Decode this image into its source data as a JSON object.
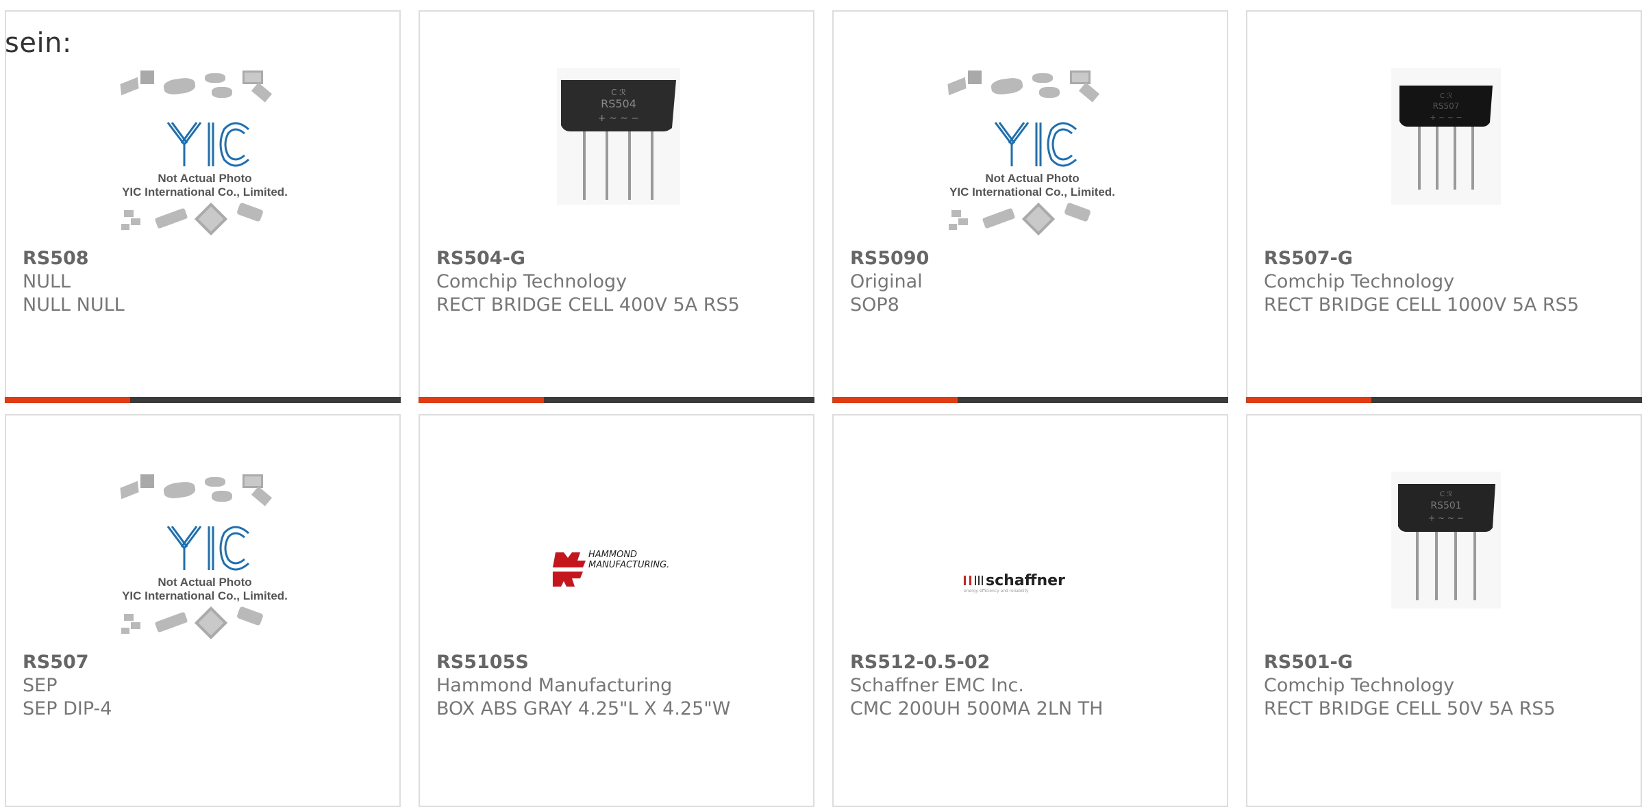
{
  "heading_fragment": "sein:",
  "products": [
    {
      "part": "RS508",
      "maker": "NULL",
      "desc": "NULL NULL",
      "image": "yic-placeholder-image"
    },
    {
      "part": "RS504-G",
      "maker": "Comchip Technology",
      "desc": "RECT BRIDGE CELL 400V 5A RS5",
      "image": "bridge-rectifier-photo",
      "chip_text": "RS504"
    },
    {
      "part": "RS5090",
      "maker": "Original",
      "desc": "SOP8",
      "image": "yic-placeholder-image"
    },
    {
      "part": "RS507-G",
      "maker": "Comchip Technology",
      "desc": "RECT BRIDGE CELL 1000V 5A RS5",
      "image": "bridge-rectifier-photo",
      "chip_text": "RS507"
    },
    {
      "part": "RS507",
      "maker": "SEP",
      "desc": "SEP DIP-4",
      "image": "yic-placeholder-image"
    },
    {
      "part": "RS5105S",
      "maker": "Hammond Manufacturing",
      "desc": "BOX ABS GRAY 4.25\"L X 4.25\"W",
      "image": "hammond-logo",
      "logo_text_1": "HAMMOND",
      "logo_text_2": "MANUFACTURING."
    },
    {
      "part": "RS512-0.5-02",
      "maker": "Schaffner EMC Inc.",
      "desc": "CMC 200UH 500MA 2LN TH",
      "image": "schaffner-logo",
      "logo_text_1": "schaffner",
      "logo_text_2": "energy efficiency and reliability"
    },
    {
      "part": "RS501-G",
      "maker": "Comchip Technology",
      "desc": "RECT BRIDGE CELL 50V 5A RS5",
      "image": "bridge-rectifier-photo",
      "chip_text": "RS501"
    }
  ],
  "placeholder": {
    "line1": "Not Actual Photo",
    "line2": "YIC International Co., Limited.",
    "logo": "YIC"
  },
  "colors": {
    "accent": "#e03b12",
    "bar": "#3b3b3b",
    "border": "#dddddd",
    "text": "#666666",
    "yic_blue": "#1b6fb5",
    "hammond_red": "#c4161c"
  }
}
